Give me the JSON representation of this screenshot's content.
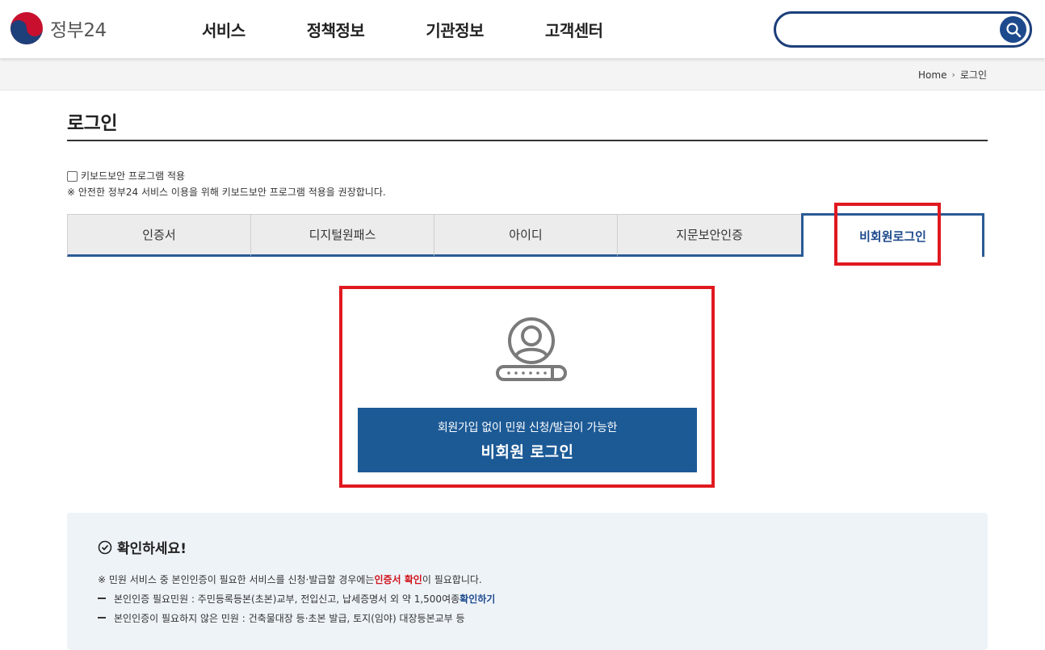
{
  "header": {
    "logo_text": "정부24",
    "nav": [
      "서비스",
      "정책정보",
      "기관정보",
      "고객센터"
    ],
    "search_placeholder": ""
  },
  "breadcrumb": {
    "home": "Home",
    "current": "로그인"
  },
  "page_title": "로그인",
  "keyboard": {
    "checkbox_label": "키보드보안 프로그램 적용",
    "note": "※ 안전한 정부24 서비스 이용을 위해 키보드보안 프로그램 적용을 권장합니다."
  },
  "tabs": [
    "인증서",
    "디지털원패스",
    "아이디",
    "지문보안인증",
    "비회원로그인"
  ],
  "active_tab": "비회원로그인",
  "guest": {
    "sub": "회원가입 없이 민원 신청/발급이 가능한",
    "main": "비회원 로그인"
  },
  "notice": {
    "title": "확인하세요!",
    "line1_pre": "※ 민원 서비스 중 본인인증이 필요한 서비스를 신청·발급할 경우에는 ",
    "line1_red": "인증서 확인",
    "line1_post": "이 필요합니다.",
    "line2_pre": "본인인증 필요민원 : 주민등록등본(초본)교부, 전입신고, 납세증명서 외 약 1,500여종 ",
    "line2_link": "확인하기",
    "line3": "본인인증이 필요하지 않은 민원 : 건축물대장 등·초본 발급, 토지(임야) 대장등본교부 등"
  },
  "colors": {
    "primary": "#1c5a96",
    "highlight": "#e0191f",
    "nav_blue": "#1d4a8c"
  }
}
